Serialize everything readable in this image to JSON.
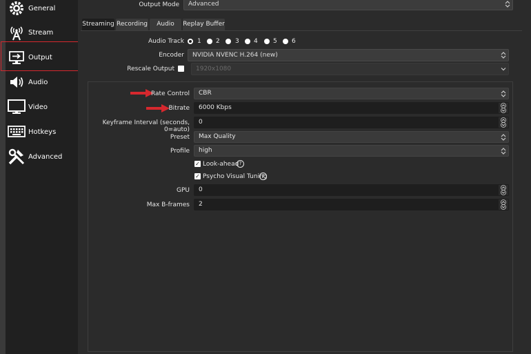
{
  "sidebar": {
    "items": [
      {
        "label": "General",
        "icon": "gear-icon"
      },
      {
        "label": "Stream",
        "icon": "antenna-icon"
      },
      {
        "label": "Output",
        "icon": "output-icon"
      },
      {
        "label": "Audio",
        "icon": "speaker-icon"
      },
      {
        "label": "Video",
        "icon": "monitor-icon"
      },
      {
        "label": "Hotkeys",
        "icon": "keyboard-icon"
      },
      {
        "label": "Advanced",
        "icon": "tools-icon"
      }
    ]
  },
  "output_mode": {
    "label": "Output Mode",
    "value": "Advanced"
  },
  "tabs": [
    "Streaming",
    "Recording",
    "Audio",
    "Replay Buffer"
  ],
  "audio_track": {
    "label": "Audio Track",
    "options": [
      "1",
      "2",
      "3",
      "4",
      "5",
      "6"
    ]
  },
  "encoder": {
    "label": "Encoder",
    "value": "NVIDIA NVENC H.264 (new)"
  },
  "rescale": {
    "label": "Rescale Output",
    "value": "1920x1080"
  },
  "settings": {
    "rate_control": {
      "label": "Rate Control",
      "value": "CBR"
    },
    "bitrate": {
      "label": "Bitrate",
      "value": "6000 Kbps"
    },
    "keyframe": {
      "label": "Keyframe Interval (seconds, 0=auto)",
      "value": "0"
    },
    "preset": {
      "label": "Preset",
      "value": "Max Quality"
    },
    "profile": {
      "label": "Profile",
      "value": "high"
    },
    "lookahead": {
      "label": "Look-ahead"
    },
    "psycho": {
      "label": "Psycho Visual Tuning"
    },
    "gpu": {
      "label": "GPU",
      "value": "0"
    },
    "bframes": {
      "label": "Max B-frames",
      "value": "2"
    }
  },
  "colors": {
    "highlight": "#d6282e",
    "sidebar_bg": "#202020",
    "panel_bg": "#2b2b2b"
  }
}
